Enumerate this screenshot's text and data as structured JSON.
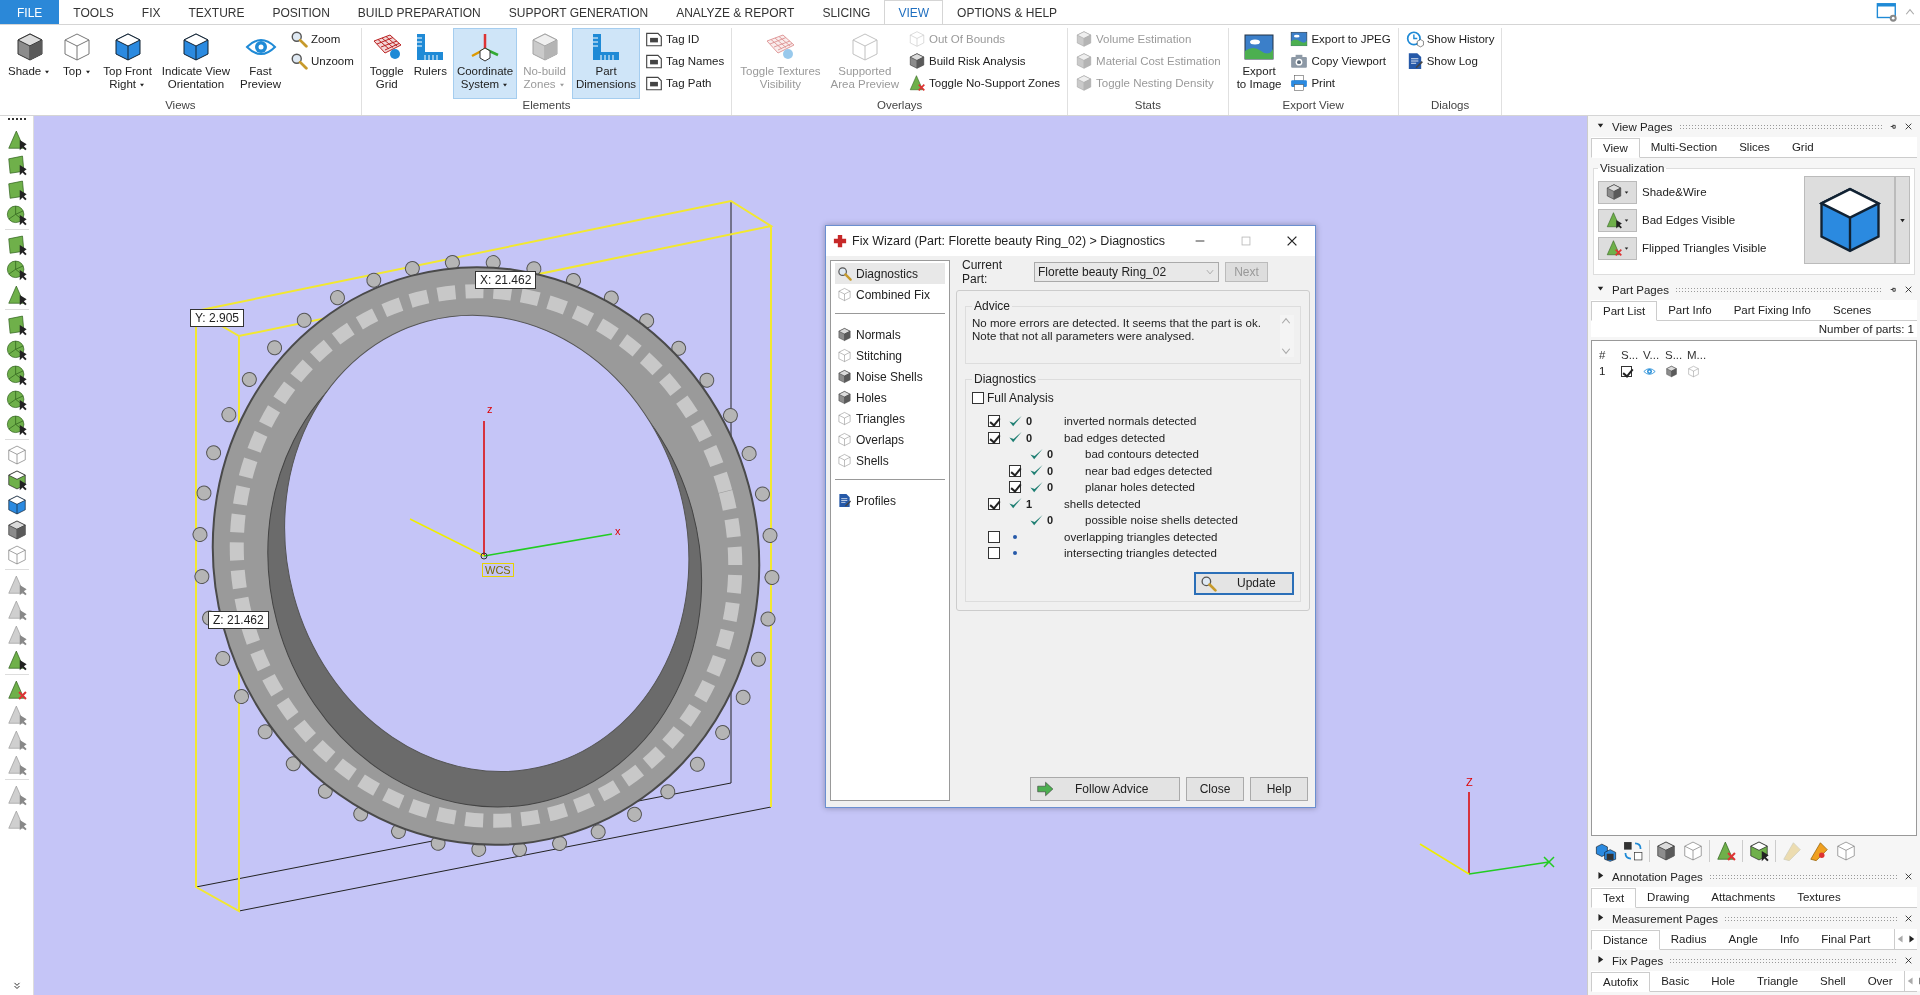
{
  "ribbon_tabs": [
    {
      "label": "FILE",
      "kind": "file",
      "selected": false
    },
    {
      "label": "TOOLS",
      "kind": "tab",
      "selected": false
    },
    {
      "label": "FIX",
      "kind": "tab",
      "selected": false
    },
    {
      "label": "TEXTURE",
      "kind": "tab",
      "selected": false
    },
    {
      "label": "POSITION",
      "kind": "tab",
      "selected": false
    },
    {
      "label": "BUILD PREPARATION",
      "kind": "tab",
      "selected": false
    },
    {
      "label": "SUPPORT GENERATION",
      "kind": "tab",
      "selected": false
    },
    {
      "label": "ANALYZE & REPORT",
      "kind": "tab",
      "selected": false
    },
    {
      "label": "SLICING",
      "kind": "tab",
      "selected": false
    },
    {
      "label": "VIEW",
      "kind": "tab",
      "selected": true
    },
    {
      "label": "OPTIONS & HELP",
      "kind": "tab",
      "selected": false
    }
  ],
  "ribbon_groups": [
    {
      "title": "Views",
      "buttons": [
        {
          "label": "Shade",
          "kind": "large",
          "dropdown": true,
          "pressed": false,
          "disabled": false
        },
        {
          "label": "Top",
          "kind": "large",
          "dropdown": true,
          "pressed": false,
          "disabled": false
        },
        {
          "label": "Top Front\nRight",
          "kind": "large",
          "dropdown": true,
          "pressed": false,
          "disabled": false
        },
        {
          "label": "Indicate View\nOrientation",
          "kind": "large",
          "dropdown": false,
          "pressed": false,
          "disabled": false
        },
        {
          "label": "Fast\nPreview",
          "kind": "large",
          "dropdown": false,
          "pressed": false,
          "disabled": false
        },
        {
          "label": "Zoom",
          "kind": "small",
          "dropdown": false,
          "pressed": false,
          "disabled": false
        },
        {
          "label": "Unzoom",
          "kind": "small",
          "dropdown": false,
          "pressed": false,
          "disabled": false
        }
      ]
    },
    {
      "title": "Elements",
      "buttons": [
        {
          "label": "Toggle\nGrid",
          "kind": "large",
          "dropdown": false,
          "pressed": false,
          "disabled": false
        },
        {
          "label": "Rulers",
          "kind": "large",
          "dropdown": false,
          "pressed": false,
          "disabled": false
        },
        {
          "label": "Coordinate\nSystem",
          "kind": "large",
          "dropdown": true,
          "pressed": true,
          "disabled": false
        },
        {
          "label": "No-build\nZones",
          "kind": "large",
          "dropdown": true,
          "pressed": false,
          "disabled": true
        },
        {
          "label": "Part\nDimensions",
          "kind": "large",
          "dropdown": false,
          "pressed": true,
          "disabled": false
        },
        {
          "label": "Tag ID",
          "kind": "small",
          "dropdown": false,
          "pressed": false,
          "disabled": false
        },
        {
          "label": "Tag Names",
          "kind": "small",
          "dropdown": false,
          "pressed": false,
          "disabled": false
        },
        {
          "label": "Tag Path",
          "kind": "small",
          "dropdown": false,
          "pressed": false,
          "disabled": false
        }
      ]
    },
    {
      "title": "Overlays",
      "buttons": [
        {
          "label": "Toggle Textures\nVisibility",
          "kind": "large",
          "dropdown": false,
          "pressed": false,
          "disabled": true
        },
        {
          "label": "Supported\nArea Preview",
          "kind": "large",
          "dropdown": false,
          "pressed": false,
          "disabled": true
        },
        {
          "label": "Out Of Bounds",
          "kind": "small",
          "dropdown": false,
          "pressed": false,
          "disabled": true
        },
        {
          "label": "Build Risk Analysis",
          "kind": "small",
          "dropdown": false,
          "pressed": false,
          "disabled": false
        },
        {
          "label": "Toggle No-Support Zones",
          "kind": "small",
          "dropdown": false,
          "pressed": false,
          "disabled": false
        }
      ]
    },
    {
      "title": "Stats",
      "buttons": [
        {
          "label": "Volume Estimation",
          "kind": "small",
          "dropdown": false,
          "pressed": false,
          "disabled": true
        },
        {
          "label": "Material Cost Estimation",
          "kind": "small",
          "dropdown": false,
          "pressed": false,
          "disabled": true
        },
        {
          "label": "Toggle Nesting Density",
          "kind": "small",
          "dropdown": false,
          "pressed": false,
          "disabled": true
        }
      ]
    },
    {
      "title": "Export View",
      "buttons": [
        {
          "label": "Export\nto Image",
          "kind": "large",
          "dropdown": false,
          "pressed": false,
          "disabled": false
        },
        {
          "label": "Export to JPEG",
          "kind": "small",
          "dropdown": false,
          "pressed": false,
          "disabled": false
        },
        {
          "label": "Copy Viewport",
          "kind": "small",
          "dropdown": false,
          "pressed": false,
          "disabled": false
        },
        {
          "label": "Print",
          "kind": "small",
          "dropdown": false,
          "pressed": false,
          "disabled": false
        }
      ]
    },
    {
      "title": "Dialogs",
      "buttons": [
        {
          "label": "Show History",
          "kind": "small",
          "dropdown": false,
          "pressed": false,
          "disabled": false
        },
        {
          "label": "Show Log",
          "kind": "small",
          "dropdown": false,
          "pressed": false,
          "disabled": false
        }
      ]
    }
  ],
  "viewport": {
    "dimension_labels": [
      "X: 21.462",
      "Y: 2.905",
      "Z: 21.462"
    ],
    "axis_labels": [
      "z",
      "x"
    ],
    "wcs_label": "WCS",
    "triad_label": "Z"
  },
  "dialog": {
    "title": "Fix Wizard (Part: Florette beauty Ring_02) > Diagnostics",
    "nav_sections": [
      [
        {
          "label": "Diagnostics",
          "selected": true
        },
        {
          "label": "Combined Fix",
          "selected": false
        }
      ],
      [
        {
          "label": "Normals",
          "selected": false
        },
        {
          "label": "Stitching",
          "selected": false
        },
        {
          "label": "Noise Shells",
          "selected": false
        },
        {
          "label": "Holes",
          "selected": false
        },
        {
          "label": "Triangles",
          "selected": false
        },
        {
          "label": "Overlaps",
          "selected": false
        },
        {
          "label": "Shells",
          "selected": false
        }
      ],
      [
        {
          "label": "Profiles",
          "selected": false
        }
      ]
    ],
    "current_part_label": "Current Part:",
    "current_part": "Florette beauty Ring_02",
    "next_button": {
      "label": "Next",
      "disabled": true
    },
    "advice_title": "Advice",
    "advice_text": "No more errors are detected. It seems that the part is ok.\nNote that not all parameters were analysed.",
    "diagnostics_title": "Diagnostics",
    "full_analysis": {
      "label": "Full Analysis",
      "checked": false
    },
    "rows": [
      {
        "kind": "check",
        "checked": true,
        "passed": true,
        "count": "0",
        "label": "inverted normals detected"
      },
      {
        "kind": "check",
        "checked": true,
        "passed": true,
        "count": "0",
        "label": "bad edges detected",
        "children": [
          {
            "kind": "plain",
            "passed": true,
            "count": "0",
            "label": "bad contours detected"
          },
          {
            "kind": "check",
            "checked": true,
            "passed": true,
            "count": "0",
            "label": "near bad edges detected"
          },
          {
            "kind": "check",
            "checked": true,
            "passed": true,
            "count": "0",
            "label": "planar holes detected"
          }
        ]
      },
      {
        "kind": "check",
        "checked": true,
        "passed": true,
        "count": "1",
        "label": "shells detected",
        "children": [
          {
            "kind": "plain",
            "passed": true,
            "count": "0",
            "label": "possible noise shells detected"
          }
        ]
      },
      {
        "kind": "check",
        "checked": false,
        "passed": false,
        "label": "overlapping triangles detected"
      },
      {
        "kind": "check",
        "checked": false,
        "passed": false,
        "label": "intersecting triangles detected"
      }
    ],
    "update_button": "Update",
    "buttons": [
      "Follow Advice",
      "Close",
      "Help"
    ]
  },
  "panels": [
    {
      "title": "View Pages",
      "expanded": true,
      "tabs": [
        {
          "label": "View",
          "selected": true
        },
        {
          "label": "Multi-Section",
          "selected": false
        },
        {
          "label": "Slices",
          "selected": false
        },
        {
          "label": "Grid",
          "selected": false
        }
      ],
      "visualization": {
        "title": "Visualization",
        "rows": [
          "Shade&Wire",
          "Bad Edges Visible",
          "Flipped Triangles Visible"
        ]
      }
    },
    {
      "title": "Part Pages",
      "expanded": true,
      "tabs": [
        {
          "label": "Part List",
          "selected": true
        },
        {
          "label": "Part Info",
          "selected": false
        },
        {
          "label": "Part Fixing Info",
          "selected": false
        },
        {
          "label": "Scenes",
          "selected": false
        }
      ],
      "part_count": "Number of parts: 1",
      "columns": [
        "#",
        "S...",
        "V...",
        "S...",
        "M..."
      ],
      "parts": [
        {
          "number": "1",
          "checked": true
        }
      ]
    },
    {
      "title": "Annotation Pages",
      "expanded": false,
      "tabs": [
        {
          "label": "Text",
          "selected": true
        },
        {
          "label": "Drawing",
          "selected": false
        },
        {
          "label": "Attachments",
          "selected": false
        },
        {
          "label": "Textures",
          "selected": false
        }
      ]
    },
    {
      "title": "Measurement Pages",
      "expanded": false,
      "scroll_arrows": true,
      "tabs": [
        {
          "label": "Distance",
          "selected": true
        },
        {
          "label": "Radius",
          "selected": false
        },
        {
          "label": "Angle",
          "selected": false
        },
        {
          "label": "Info",
          "selected": false
        },
        {
          "label": "Final Part",
          "selected": false
        }
      ]
    },
    {
      "title": "Fix Pages",
      "expanded": false,
      "scroll_arrows": true,
      "tabs": [
        {
          "label": "Autofix",
          "selected": true
        },
        {
          "label": "Basic",
          "selected": false
        },
        {
          "label": "Hole",
          "selected": false
        },
        {
          "label": "Triangle",
          "selected": false
        },
        {
          "label": "Shell",
          "selected": false
        },
        {
          "label": "Over",
          "selected": false
        }
      ]
    }
  ]
}
